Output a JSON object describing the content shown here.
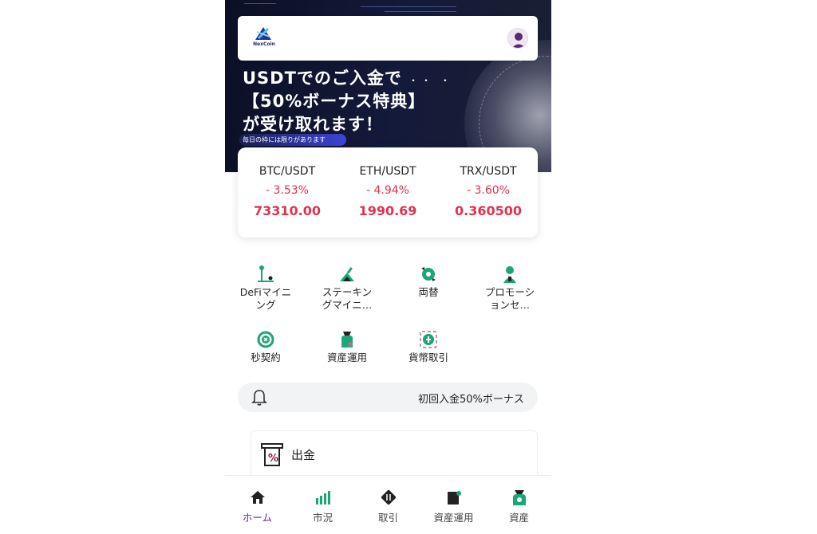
{
  "header": {
    "logo_text": "NexCoin"
  },
  "banner": {
    "headline": "USDTでのご入金で\n【50%ボーナス特典】\nが受け取れます！",
    "dots": "・・ ・",
    "note": "毎日の枠には限りがあります"
  },
  "tickers": [
    {
      "pair": "BTC/USDT",
      "change": "- 3.53%",
      "price": "73310.00"
    },
    {
      "pair": "ETH/USDT",
      "change": "- 4.94%",
      "price": "1990.69"
    },
    {
      "pair": "TRX/USDT",
      "change": "- 3.60%",
      "price": "0.360500"
    }
  ],
  "menu": [
    {
      "label": "DeFiマイニ\nング",
      "icon": "defi-mining-icon"
    },
    {
      "label": "ステーキン\nグマイニ…",
      "icon": "staking-icon"
    },
    {
      "label": "両替",
      "icon": "exchange-icon"
    },
    {
      "label": "プロモーシ\nョンセ…",
      "icon": "promotion-icon"
    },
    {
      "label": "秒契約",
      "icon": "second-contract-icon"
    },
    {
      "label": "資産運用",
      "icon": "asset-management-icon"
    },
    {
      "label": "貨幣取引",
      "icon": "currency-trade-icon"
    }
  ],
  "notice": {
    "text": "初回入金50%ボーナス"
  },
  "withdraw": {
    "label": "出金"
  },
  "nav": [
    {
      "label": "ホーム",
      "icon": "home-icon",
      "active": true
    },
    {
      "label": "市況",
      "icon": "market-icon",
      "active": false
    },
    {
      "label": "取引",
      "icon": "trade-icon",
      "active": false
    },
    {
      "label": "資産運用",
      "icon": "wallet-icon",
      "active": false
    },
    {
      "label": "資産",
      "icon": "assets-icon",
      "active": false
    }
  ],
  "colors": {
    "accent_green": "#1aa57a",
    "down_red": "#e0334e",
    "nav_active": "#6b2c8c"
  }
}
